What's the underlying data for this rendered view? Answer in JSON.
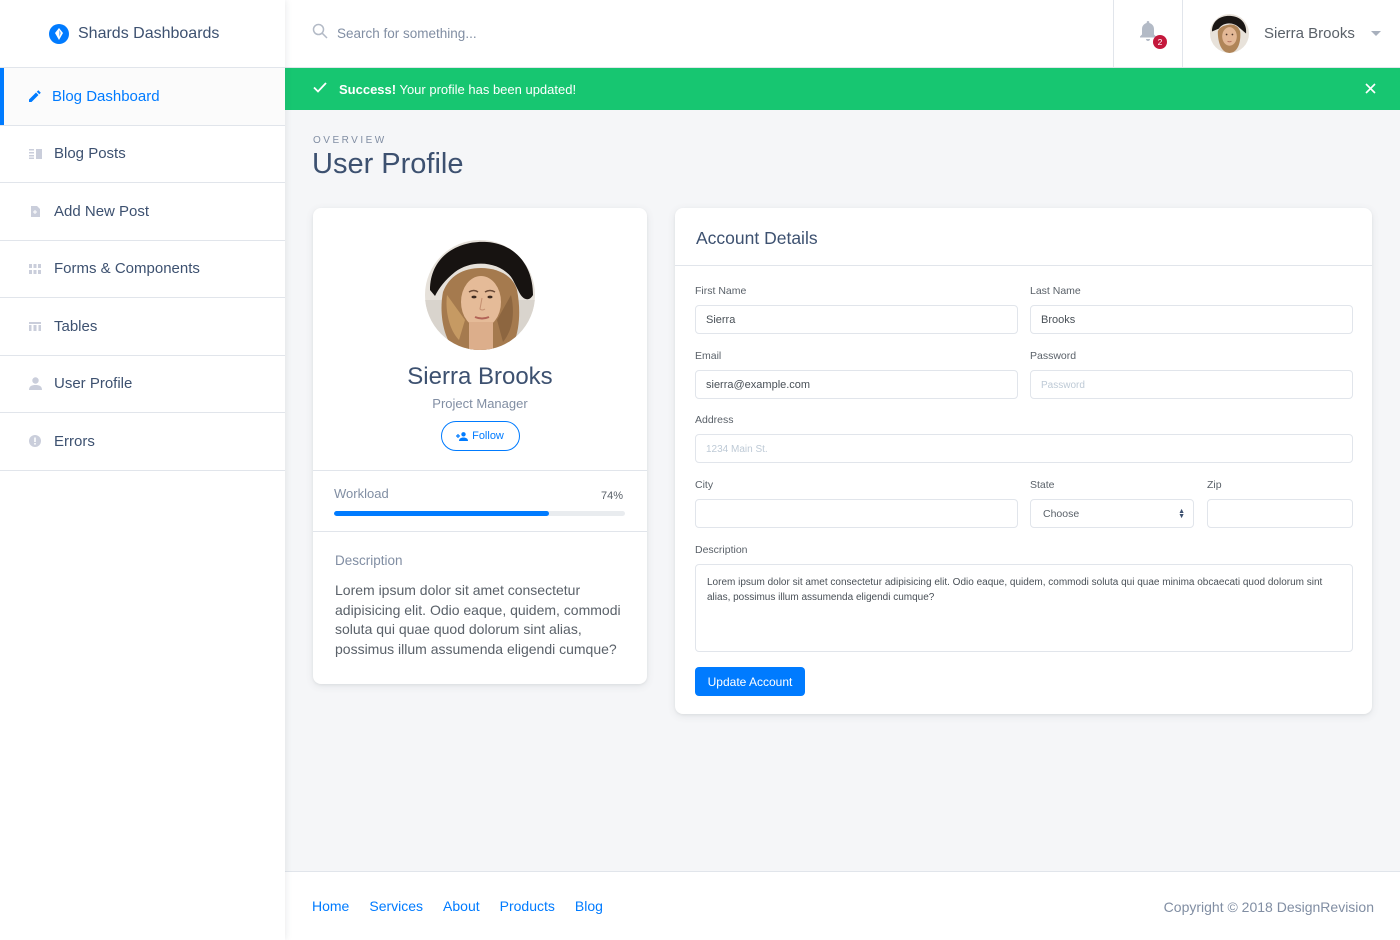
{
  "brand": {
    "name": "Shards Dashboards",
    "icon": "shards-logo-icon"
  },
  "sidebar": {
    "items": [
      {
        "label": "Blog Dashboard",
        "icon": "pencil-icon",
        "active": true
      },
      {
        "label": "Blog Posts",
        "icon": "view-module-icon",
        "active": false
      },
      {
        "label": "Add New Post",
        "icon": "note-add-icon",
        "active": false
      },
      {
        "label": "Forms & Components",
        "icon": "grid-icon",
        "active": false
      },
      {
        "label": "Tables",
        "icon": "table-icon",
        "active": false
      },
      {
        "label": "User Profile",
        "icon": "person-icon",
        "active": false
      },
      {
        "label": "Errors",
        "icon": "error-icon",
        "active": false
      }
    ]
  },
  "topbar": {
    "search_placeholder": "Search for something...",
    "notification_count": "2",
    "user_name": "Sierra Brooks"
  },
  "alert": {
    "strong": "Success!",
    "message": " Your profile has been updated!",
    "color": "#17c671"
  },
  "page": {
    "subtitle": "OVERVIEW",
    "title": "User Profile"
  },
  "profile": {
    "name": "Sierra Brooks",
    "role": "Project Manager",
    "follow_label": "Follow",
    "workload_label": "Workload",
    "workload_value": "74%",
    "workload_percent": 74,
    "description_label": "Description",
    "description": "Lorem ipsum dolor sit amet consectetur adipisicing elit. Odio eaque, quidem, commodi soluta qui quae quod dolorum sint alias, possimus illum assumenda eligendi cumque?"
  },
  "account": {
    "title": "Account Details",
    "first_name_label": "First Name",
    "first_name_value": "Sierra",
    "last_name_label": "Last Name",
    "last_name_value": "Brooks",
    "email_label": "Email",
    "email_value": "sierra@example.com",
    "password_label": "Password",
    "password_placeholder": "Password",
    "address_label": "Address",
    "address_placeholder": "1234 Main St.",
    "city_label": "City",
    "city_value": "",
    "state_label": "State",
    "state_selected": "Choose",
    "zip_label": "Zip",
    "zip_value": "",
    "description_label": "Description",
    "description_value": "Lorem ipsum dolor sit amet consectetur adipisicing elit. Odio eaque, quidem, commodi soluta qui quae minima obcaecati quod dolorum sint alias, possimus illum assumenda eligendi cumque?",
    "submit_label": "Update Account"
  },
  "footer": {
    "links": [
      "Home",
      "Services",
      "About",
      "Products",
      "Blog"
    ],
    "copyright": "Copyright © 2018 DesignRevision"
  },
  "colors": {
    "accent": "#007bff",
    "success": "#17c671",
    "danger": "#c4183c",
    "text": "#3d5170",
    "muted": "#818ea3"
  }
}
